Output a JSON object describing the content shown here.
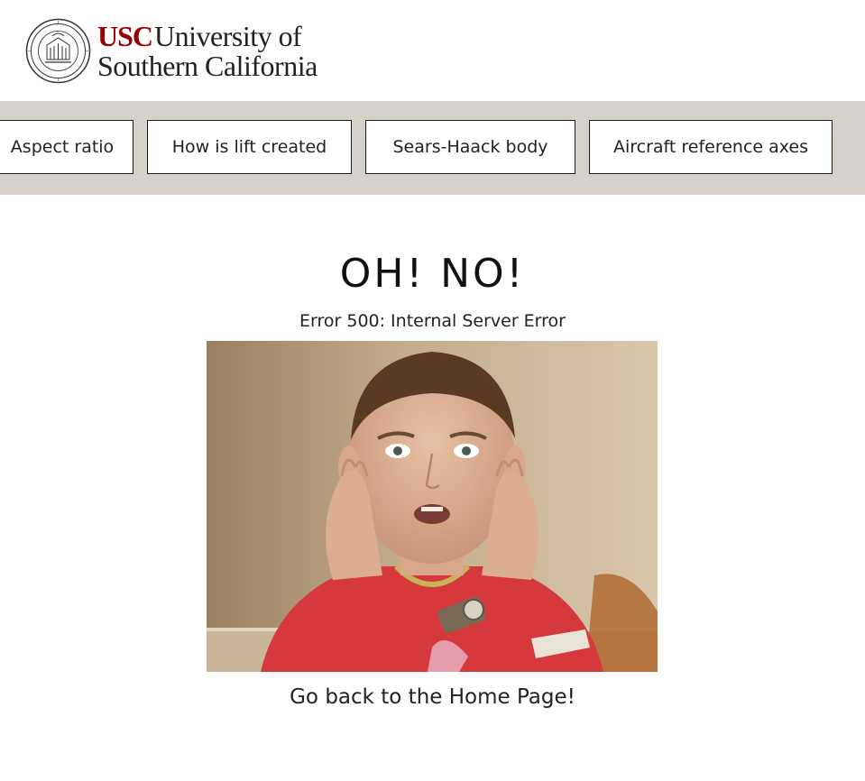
{
  "header": {
    "logo_abbrev": "USC",
    "logo_line1": "University of",
    "logo_line2": "Southern California",
    "seal_icon": "usc-seal-icon",
    "brand_color": "#990000"
  },
  "nav": {
    "items": [
      {
        "label": "Aspect ratio"
      },
      {
        "label": "How is lift created"
      },
      {
        "label": "Sears-Haack body"
      },
      {
        "label": "Aircraft reference axes"
      }
    ],
    "background": "#d6d2ca"
  },
  "error": {
    "title": "OH! NO!",
    "message": "Error 500: Internal Server Error",
    "image_alt": "photo of a surprised man holding his face",
    "home_link": "Go back to the Home Page!"
  }
}
